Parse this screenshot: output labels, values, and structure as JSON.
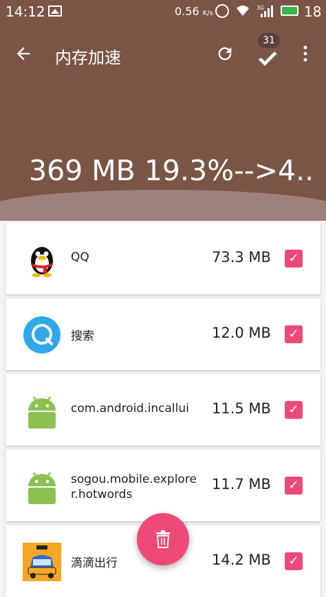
{
  "status_bar": {
    "time": "14:12",
    "net_speed": "0.56",
    "net_speed_unit": "K/s",
    "network_type": "3G",
    "battery_level": "18",
    "battery_color": "#39b54a"
  },
  "toolbar": {
    "title": "内存加速",
    "back_icon": "arrow-left-icon",
    "refresh_icon": "refresh-icon",
    "check_icon": "check-icon",
    "selected_count": "31",
    "more_icon": "more-vert-icon"
  },
  "summary": "369 MB 19.3%-->4..",
  "apps": [
    {
      "name": "QQ",
      "size": "73.3 MB",
      "checked": true,
      "icon": "qq-penguin-icon"
    },
    {
      "name": "搜索",
      "size": "12.0 MB",
      "checked": true,
      "icon": "search-app-icon"
    },
    {
      "name": "com.android.incallui",
      "size": "11.5 MB",
      "checked": true,
      "icon": "android-icon"
    },
    {
      "name": "sogou.mobile.explorer.hotwords",
      "size": "11.7 MB",
      "checked": true,
      "icon": "android-icon"
    },
    {
      "name": "滴滴出行",
      "size": "14.2 MB",
      "checked": true,
      "icon": "didi-taxi-icon"
    }
  ],
  "fab": {
    "icon": "trash-icon"
  },
  "colors": {
    "primary": "#7a5546",
    "accent": "#ee4a78",
    "android_green": "#8cc151",
    "search_blue": "#2fa7e8"
  }
}
